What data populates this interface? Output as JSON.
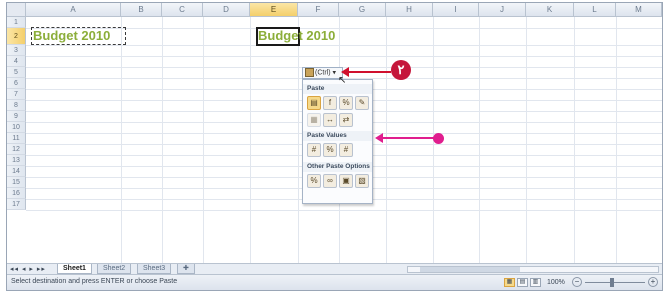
{
  "columns": [
    "A",
    "B",
    "C",
    "D",
    "E",
    "F",
    "G",
    "H",
    "I",
    "J",
    "K",
    "L",
    "M"
  ],
  "selected_column": "E",
  "rows": [
    "1",
    "2",
    "3",
    "4",
    "5",
    "6",
    "7",
    "8",
    "9",
    "10",
    "11",
    "12",
    "13",
    "14",
    "15",
    "16",
    "17"
  ],
  "selected_row": "2",
  "cells": {
    "a2": "Budget 2010",
    "e2": "Budget 2010"
  },
  "paste_options": {
    "button_label": "(Ctrl)",
    "section_paste": "Paste",
    "section_values": "Paste Values",
    "section_other": "Other Paste Options"
  },
  "annotations": {
    "step_number": "٢"
  },
  "sheet_tabs": [
    "Sheet1",
    "Sheet2",
    "Sheet3"
  ],
  "active_sheet": "Sheet1",
  "status": {
    "message": "Select destination and press ENTER or choose Paste",
    "zoom": "100%"
  },
  "colors": {
    "budget_text": "#8cae3a",
    "callout_red": "#c5163b",
    "arrow_pink": "#e01d8e",
    "selected_header": "#f4cf6b"
  }
}
